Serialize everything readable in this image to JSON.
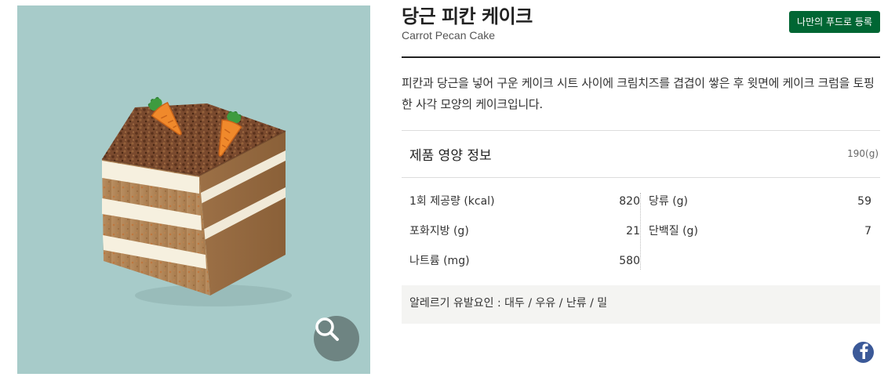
{
  "product": {
    "name_ko": "당근 피칸 케이크",
    "name_en": "Carrot Pecan Cake",
    "description": "피칸과 당근을 넣어 구운 케이크 시트 사이에 크림치즈를 겹겹이 쌓은 후 윗면에 케이크 크럼을 토핑한 사각 모양의 케이크입니다.",
    "image_icon": "carrot-pecan-cake-photo"
  },
  "actions": {
    "my_food_label": "나만의 푸드로 등록",
    "zoom_icon": "magnifier-icon",
    "share_icon": "facebook-icon"
  },
  "nutrition": {
    "title": "제품 영양 정보",
    "serving": "190(g)",
    "left": [
      {
        "label": "1회 제공량 (kcal)",
        "value": "820"
      },
      {
        "label": "포화지방 (g)",
        "value": "21"
      },
      {
        "label": "나트륨 (mg)",
        "value": "580"
      }
    ],
    "right": [
      {
        "label": "당류 (g)",
        "value": "59"
      },
      {
        "label": "단백질 (g)",
        "value": "7"
      }
    ]
  },
  "allergy": {
    "text": "알레르기 유발요인 : 대두 / 우유 / 난류 / 밀"
  },
  "colors": {
    "image_background": "#a7cbc9",
    "brand_green": "#006633",
    "facebook_blue": "#3b5998"
  }
}
